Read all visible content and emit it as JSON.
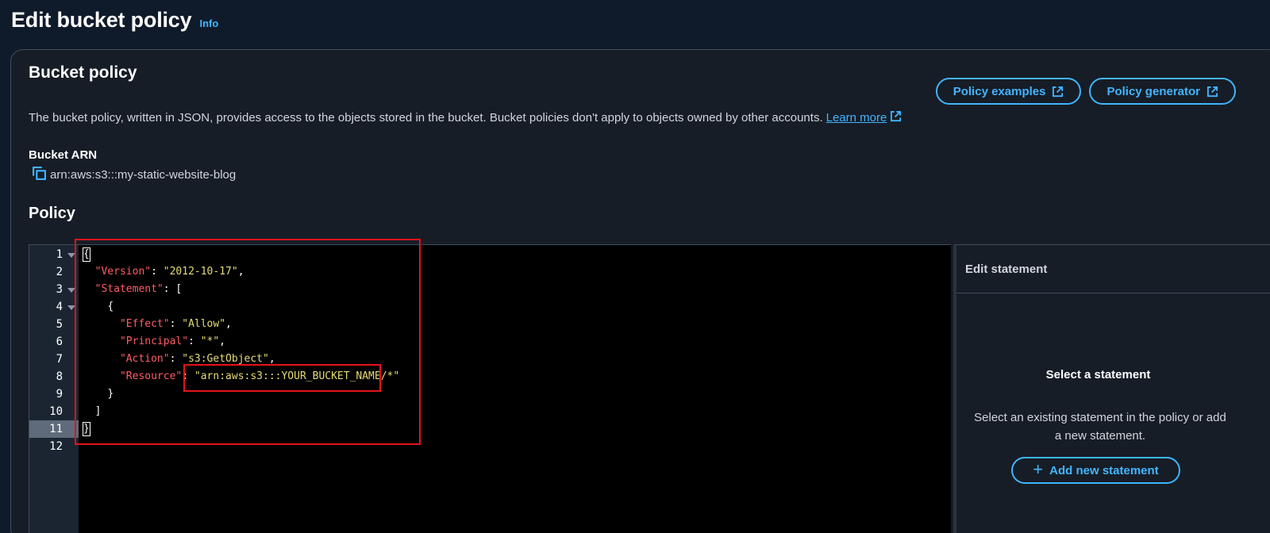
{
  "header": {
    "title": "Edit bucket policy",
    "info_label": "Info"
  },
  "bucket_policy": {
    "title": "Bucket policy",
    "examples_button": "Policy examples",
    "generator_button": "Policy generator",
    "description": "The bucket policy, written in JSON, provides access to the objects stored in the bucket. Bucket policies don't apply to objects owned by other accounts.",
    "learn_more": "Learn more",
    "arn_label": "Bucket ARN",
    "arn_value": "arn:aws:s3:::my-static-website-blog"
  },
  "policy": {
    "title": "Policy",
    "line_numbers": [
      "1",
      "2",
      "3",
      "4",
      "5",
      "6",
      "7",
      "8",
      "9",
      "10",
      "11",
      "12"
    ],
    "active_line": 11,
    "code": {
      "open_brace": "{",
      "version_key": "\"Version\"",
      "version_value": "\"2012-10-17\"",
      "statement_key": "\"Statement\"",
      "open_bracket": "[",
      "stmt_open": "{",
      "effect_key": "\"Effect\"",
      "effect_value": "\"Allow\"",
      "principal_key": "\"Principal\"",
      "principal_value": "\"*\"",
      "action_key": "\"Action\"",
      "action_value": "\"s3:GetObject\"",
      "resource_key": "\"Resource\"",
      "resource_value": "\"arn:aws:s3:::YOUR_BUCKET_NAME/*\"",
      "stmt_close": "}",
      "close_bracket": "]",
      "close_brace": "}"
    }
  },
  "statement_panel": {
    "header": "Edit statement",
    "empty_title": "Select a statement",
    "empty_description": "Select an existing statement in the policy or add a new statement.",
    "add_button": "Add new statement"
  },
  "colors": {
    "accent": "#42b4ff",
    "highlight": "#e4131b",
    "json_key": "#ff5d64",
    "json_string": "#e6db74"
  },
  "icons": [
    "external-link-icon",
    "copy-icon",
    "fold-arrow-icon",
    "plus-icon"
  ]
}
